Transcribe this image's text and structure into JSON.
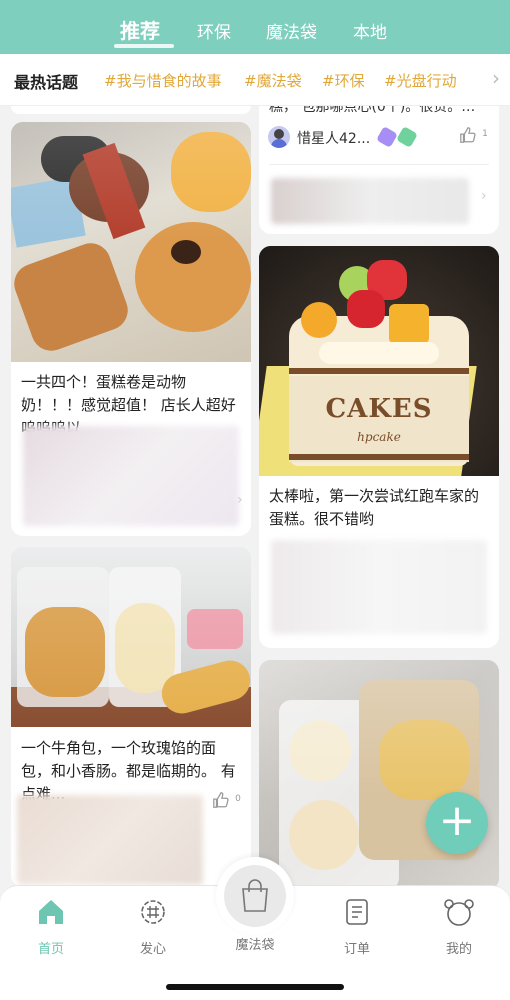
{
  "top_tabs": {
    "recommend": "推荐",
    "eco": "环保",
    "magic_bag": "魔法袋",
    "local": "本地"
  },
  "topics": {
    "title": "最热话题",
    "items": [
      "#我与惜食的故事",
      "#魔法袋",
      "#环保",
      "#光盘行动"
    ]
  },
  "feed": {
    "top_right_partial": {
      "caption_partial": "糕，    包那哪点心(0个)。很贵。…",
      "author": "惜星人42...",
      "like_count": "1"
    },
    "cards": [
      {
        "caption": "一共四个！蛋糕卷是动物奶！！！感觉超值！ 店长人超好呜呜呜以..."
      },
      {
        "caption": "太棒啦，第一次尝试红跑车家的蛋糕。很不错哟",
        "cake_text": "CAKES",
        "cake_sub": "hpcake"
      },
      {
        "caption": "一个牛角包，一个玫瑰馅的面包，和小香肠。都是临期的。 有点难...",
        "like_count": "0"
      },
      {
        "caption": ""
      }
    ]
  },
  "fab": {
    "icon": "plus-icon"
  },
  "bottom_nav": {
    "home": "首页",
    "post": "发心",
    "magic_bag": "魔法袋",
    "orders": "订单",
    "mine": "我的"
  },
  "colors": {
    "accent": "#7fcfbf",
    "topic": "#e0a83a",
    "fab": "#6fcdb9"
  }
}
